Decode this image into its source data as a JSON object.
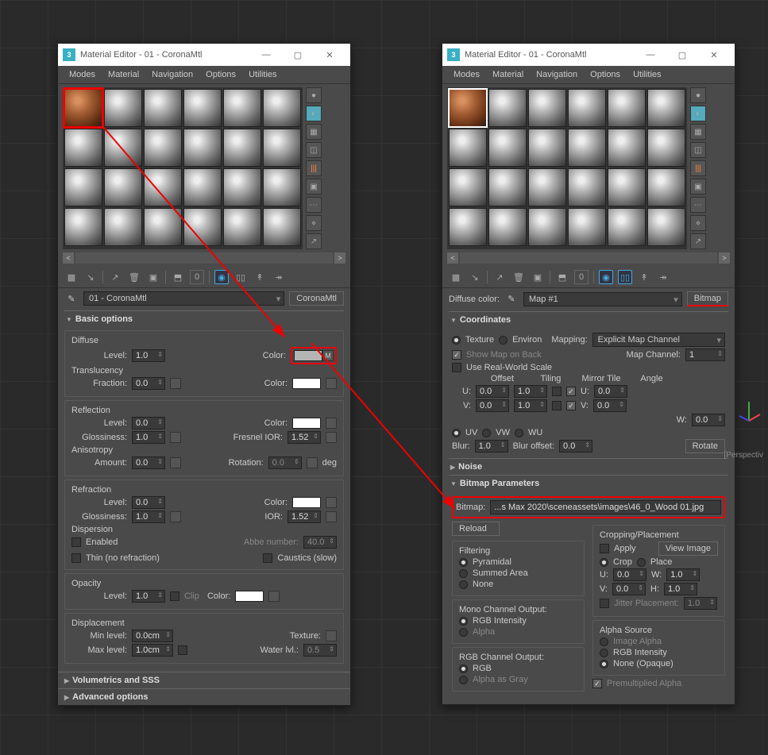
{
  "windowLeft": {
    "title": "Material Editor - 01 - CoronaMtl",
    "menus": [
      "Modes",
      "Material",
      "Navigation",
      "Options",
      "Utilities"
    ],
    "material_name": "01 - CoronaMtl",
    "material_type": "CoronaMtl",
    "rollouts": {
      "basic": {
        "title": "Basic options",
        "diffuse": {
          "label": "Diffuse",
          "level_lbl": "Level:",
          "level": "1.0",
          "color_lbl": "Color:",
          "map_btn": "M"
        },
        "translucency": {
          "label": "Translucency",
          "fraction_lbl": "Fraction:",
          "fraction": "0.0",
          "color_lbl": "Color:"
        },
        "reflection": {
          "label": "Reflection",
          "level_lbl": "Level:",
          "level": "0.0",
          "color_lbl": "Color:",
          "gloss_lbl": "Glossiness:",
          "gloss": "1.0",
          "ior_lbl": "Fresnel IOR:",
          "ior": "1.52",
          "aniso_lbl": "Anisotropy",
          "amount_lbl": "Amount:",
          "amount": "0.0",
          "rot_lbl": "Rotation:",
          "rot": "0.0",
          "deg": "deg"
        },
        "refraction": {
          "label": "Refraction",
          "level_lbl": "Level:",
          "level": "0.0",
          "color_lbl": "Color:",
          "gloss_lbl": "Glossiness:",
          "gloss": "1.0",
          "ior_lbl": "IOR:",
          "ior": "1.52",
          "disp_lbl": "Dispersion",
          "enabled_lbl": "Enabled",
          "abbe_lbl": "Abbe number:",
          "abbe": "40.0",
          "thin_lbl": "Thin (no refraction)",
          "caustics_lbl": "Caustics (slow)"
        },
        "opacity": {
          "label": "Opacity",
          "level_lbl": "Level:",
          "level": "1.0",
          "clip_lbl": "Clip",
          "color_lbl": "Color:"
        },
        "displacement": {
          "label": "Displacement",
          "min_lbl": "Min level:",
          "min": "0.0cm",
          "tex_lbl": "Texture:",
          "max_lbl": "Max level:",
          "max": "1.0cm",
          "water_lbl": "Water lvl.:",
          "water": "0.5"
        }
      },
      "volumetrics": "Volumetrics and SSS",
      "advanced": "Advanced options"
    }
  },
  "windowRight": {
    "title": "Material Editor - 01 - CoronaMtl",
    "menus": [
      "Modes",
      "Material",
      "Navigation",
      "Options",
      "Utilities"
    ],
    "diffuse_color_lbl": "Diffuse color:",
    "map_name": "Map #1",
    "map_type": "Bitmap",
    "coords": {
      "title": "Coordinates",
      "texture": "Texture",
      "environ": "Environ",
      "mapping_lbl": "Mapping:",
      "mapping": "Explicit Map Channel",
      "show_back": "Show Map on Back",
      "map_channel_lbl": "Map Channel:",
      "map_channel": "1",
      "real_world": "Use Real-World Scale",
      "offset_hdr": "Offset",
      "tiling_hdr": "Tiling",
      "mirror_hdr": "Mirror Tile",
      "angle_hdr": "Angle",
      "u_lbl": "U:",
      "u_off": "0.0",
      "u_tile": "1.0",
      "u_ang": "0.0",
      "v_lbl": "V:",
      "v_off": "0.0",
      "v_tile": "1.0",
      "v_ang": "0.0",
      "w_lbl": "W:",
      "w_ang": "0.0",
      "uv": "UV",
      "vw": "VW",
      "wu": "WU",
      "blur_lbl": "Blur:",
      "blur": "1.0",
      "blur_off_lbl": "Blur offset:",
      "blur_off": "0.0",
      "rotate": "Rotate"
    },
    "noise": "Noise",
    "bitmap": {
      "title": "Bitmap Parameters",
      "lbl": "Bitmap:",
      "path": "...s Max 2020\\sceneassets\\images\\46_0_Wood 01.jpg",
      "reload": "Reload",
      "filtering": {
        "title": "Filtering",
        "pyr": "Pyramidal",
        "sum": "Summed Area",
        "none": "None"
      },
      "mono": {
        "title": "Mono Channel Output:",
        "rgb": "RGB Intensity",
        "alpha": "Alpha"
      },
      "rgbout": {
        "title": "RGB Channel Output:",
        "rgb": "RGB",
        "alpha": "Alpha as Gray"
      },
      "crop": {
        "title": "Cropping/Placement",
        "apply": "Apply",
        "view": "View Image",
        "crop": "Crop",
        "place": "Place",
        "u_lbl": "U:",
        "u": "0.0",
        "w_lbl": "W:",
        "w": "1.0",
        "v_lbl": "V:",
        "v": "0.0",
        "h_lbl": "H:",
        "h": "1.0",
        "jitter_lbl": "Jitter Placement:",
        "jitter": "1.0"
      },
      "alpha": {
        "title": "Alpha Source",
        "img": "Image Alpha",
        "rgb": "RGB Intensity",
        "none": "None (Opaque)",
        "premul": "Premultiplied Alpha"
      }
    }
  },
  "viewport_label": "[Perspectiv"
}
